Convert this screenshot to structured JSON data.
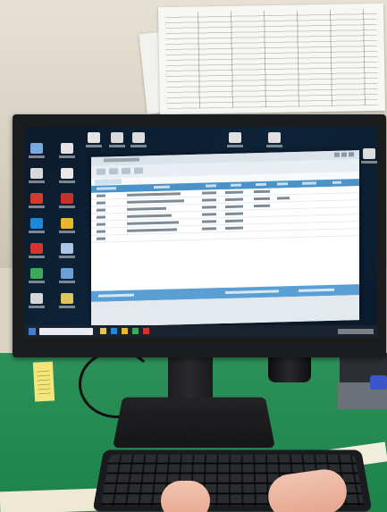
{
  "scene": {
    "description_hidden": "",
    "objects": {
      "wall_paper": "paper-sheet",
      "monitor": "monitor",
      "screen": "screen",
      "keyboard": "keyboard",
      "desk": "desk",
      "hands": "hands"
    }
  },
  "colors": {
    "desk_green": "#1f8a4f",
    "window_header_blue": "#4a93c9",
    "window_footer_blue": "#5a9fd4",
    "sticky_yellow": "#f4e77a"
  },
  "icons": {
    "desktop": [
      "app-icon",
      "pdf-icon",
      "edge-icon",
      "chrome-icon",
      "folder-icon",
      "excel-icon"
    ]
  }
}
